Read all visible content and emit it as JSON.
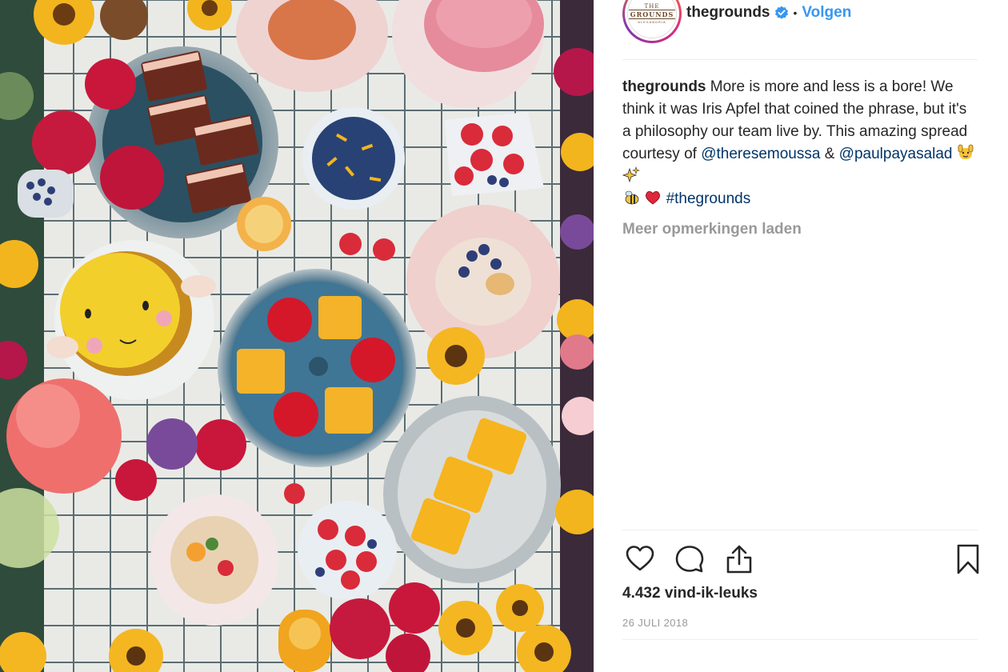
{
  "post": {
    "avatar_text": {
      "top": "THE",
      "main": "GROUNDS",
      "sub": "ALEXANDRIA"
    },
    "username": "thegrounds",
    "separator": "•",
    "follow_label": "Volgen",
    "caption": {
      "username": "thegrounds",
      "text": "More is more and less is a bore! We think it was Iris Apfel that coined the phrase, but it's a philosophy our team live by. This amazing spread courtesy of",
      "mention1": "@theresemoussa",
      "amp": "&",
      "mention2": "@paulpayasalad",
      "hashtag": "#thegrounds"
    },
    "load_more_label": "Meer opmerkingen laden",
    "likes": "4.432 vind-ik-leuks",
    "date": "26 JULI 2018",
    "icons": [
      "heart-icon",
      "comment-icon",
      "share-icon",
      "bookmark-icon",
      "verified-badge-icon"
    ],
    "colors": {
      "accent": "#3897f0",
      "link": "#003569",
      "muted": "#999999",
      "text": "#262626"
    }
  }
}
